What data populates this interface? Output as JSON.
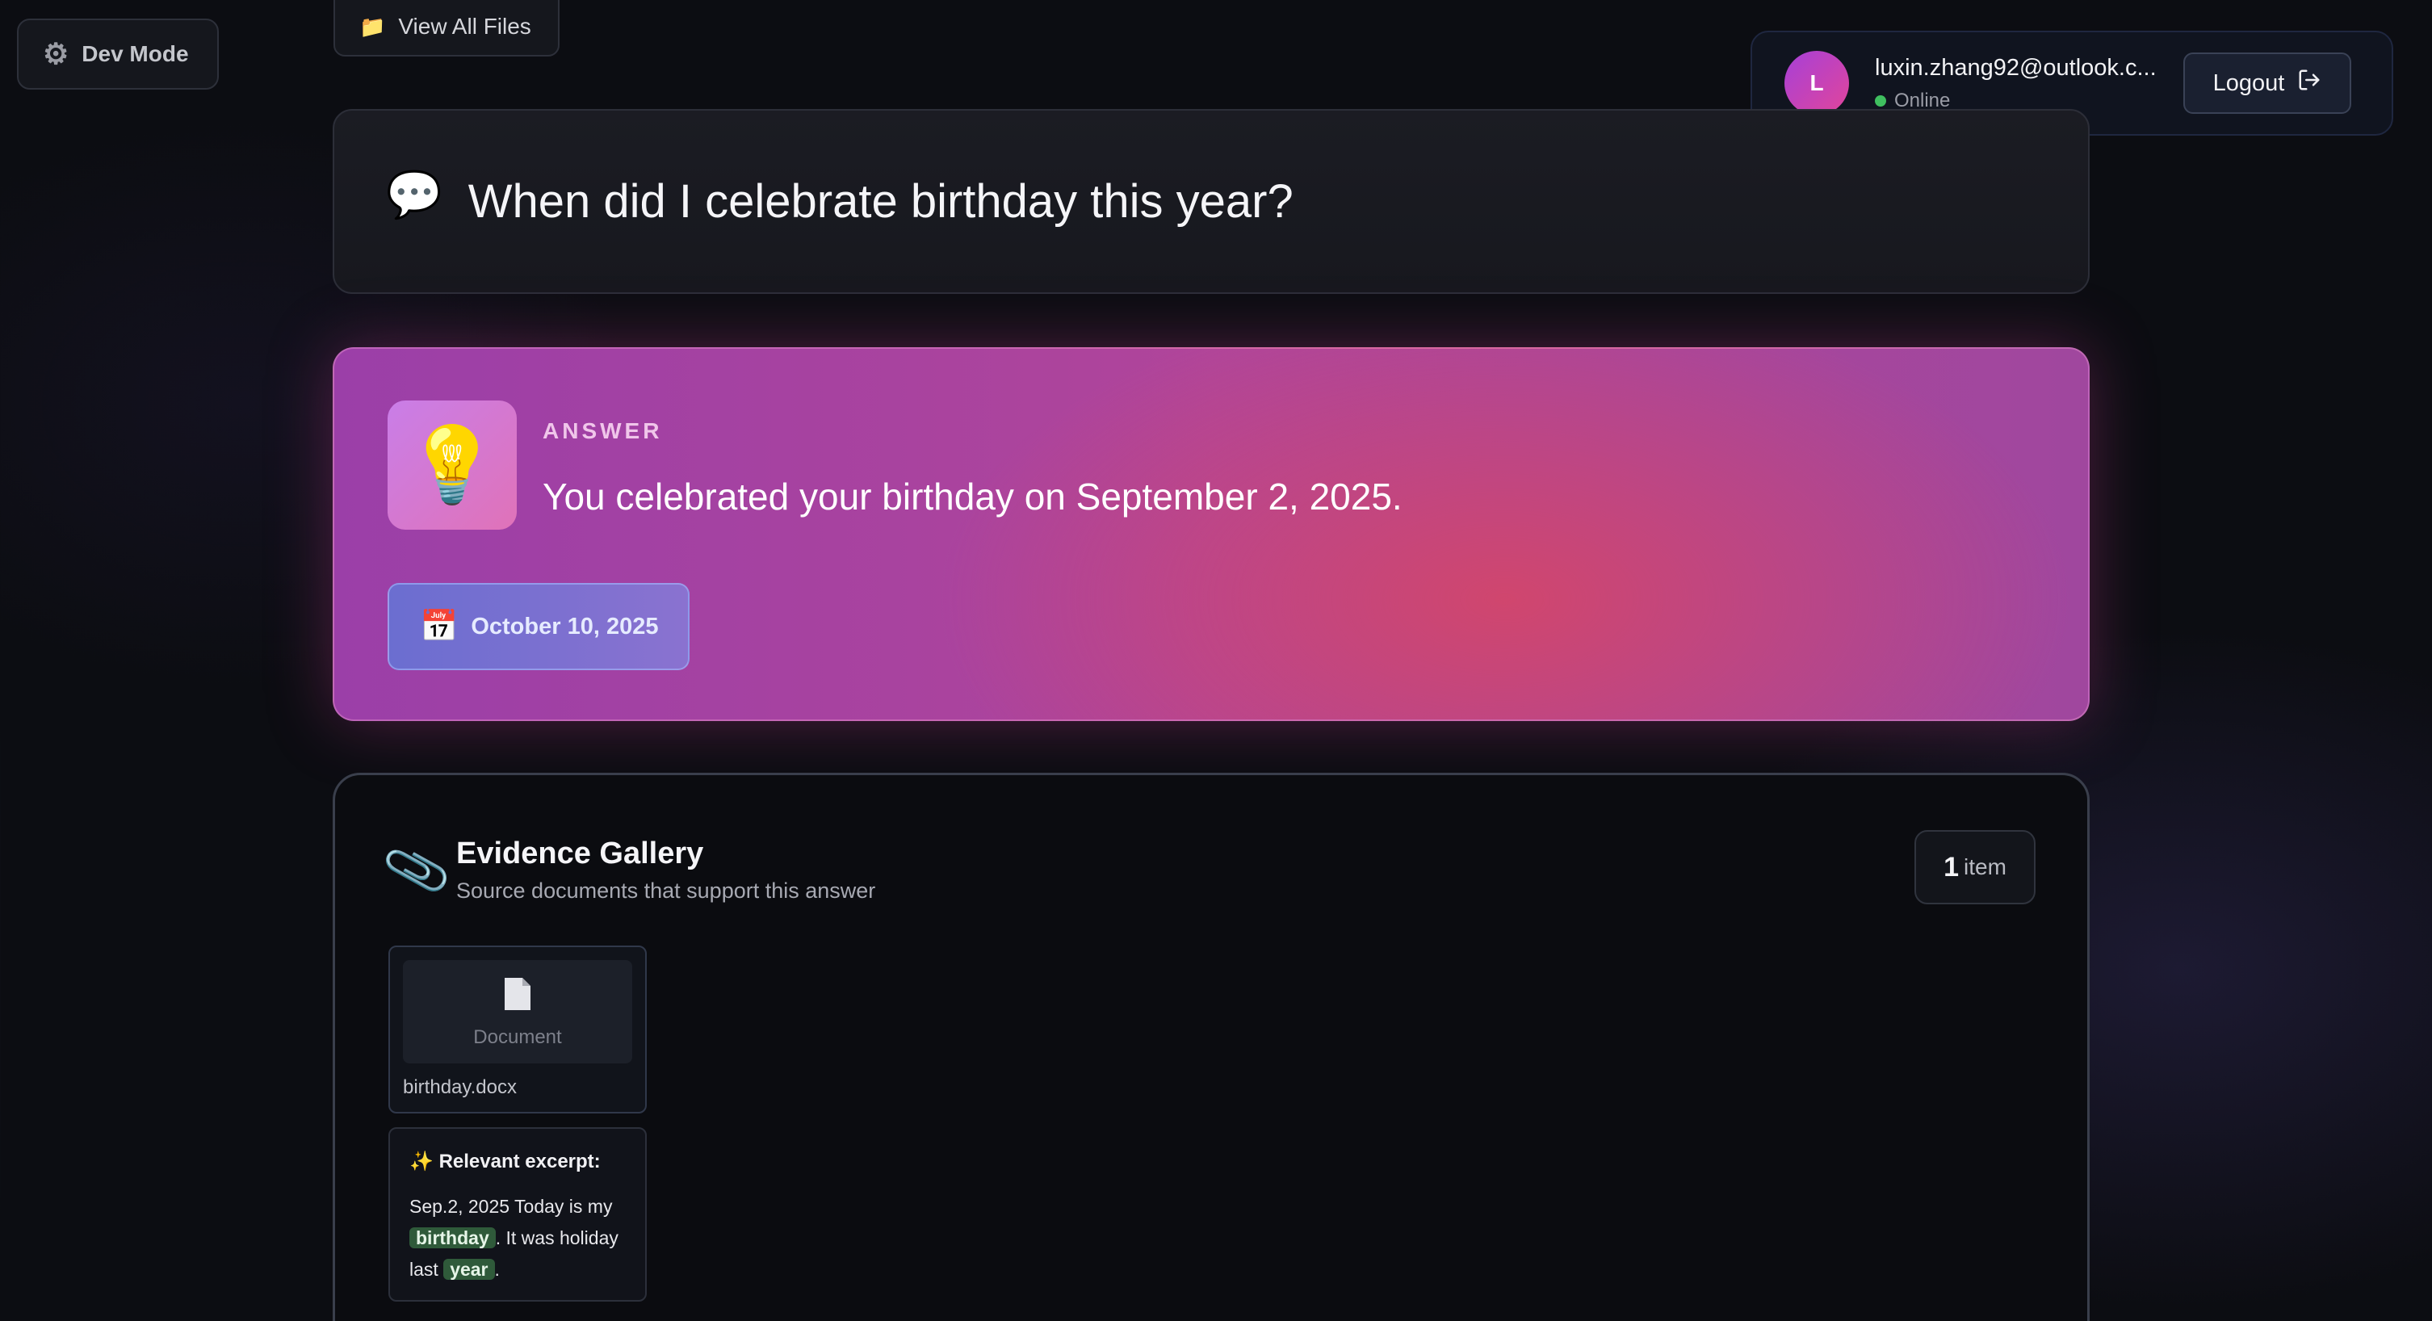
{
  "toolbar": {
    "dev_mode_icon": "gear-icon",
    "dev_mode_label": "Dev Mode",
    "view_files_icon": "folder-icon",
    "view_files_label": "View All Files"
  },
  "user": {
    "avatar_initial": "L",
    "email": "luxin.zhang92@outlook.c...",
    "status": "Online",
    "status_color": "#3fbf5f",
    "logout_label": "Logout"
  },
  "question": {
    "icon": "speech-bubble-icon",
    "text": "When did I celebrate birthday this year?"
  },
  "answer": {
    "icon": "lightbulb-icon",
    "label": "ANSWER",
    "text": "You celebrated your birthday on September 2, 2025.",
    "date_icon": "calendar-icon",
    "date": "October 10, 2025"
  },
  "evidence": {
    "icon": "paperclip-icon",
    "title": "Evidence Gallery",
    "subtitle": "Source documents that support this answer",
    "count": "1",
    "count_unit": "item",
    "documents": [
      {
        "type_icon": "document-icon",
        "type_label": "Document",
        "filename": "birthday.docx"
      }
    ],
    "excerpt": {
      "icon": "sparkles-icon",
      "heading": "Relevant excerpt:",
      "part1": "Sep.2, 2025 Today is my ",
      "highlight1": "birthday",
      "part2": ". It was holiday last ",
      "highlight2": "year",
      "part3": "."
    }
  }
}
